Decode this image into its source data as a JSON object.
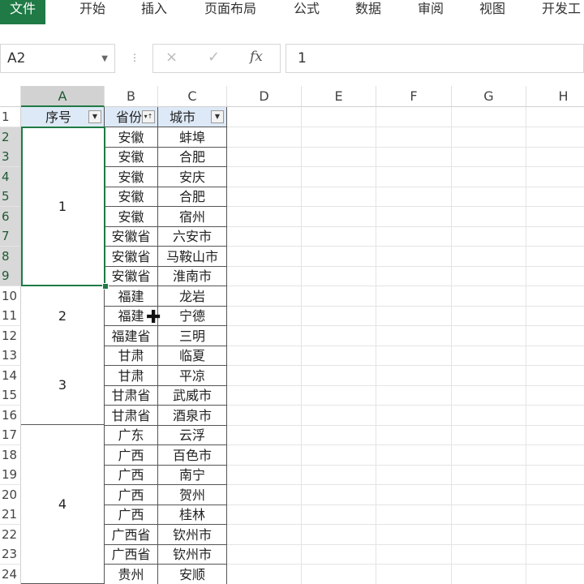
{
  "ribbon": {
    "tabs": [
      "文件",
      "开始",
      "插入",
      "页面布局",
      "公式",
      "数据",
      "审阅",
      "视图",
      "开发工"
    ]
  },
  "formula_bar": {
    "name_box": "A2",
    "cancel_glyph": "×",
    "confirm_glyph": "✓",
    "fx_label": "fx",
    "value": "1"
  },
  "columns": [
    "A",
    "B",
    "C",
    "D",
    "E",
    "F",
    "G",
    "H"
  ],
  "rows": [
    "1",
    "2",
    "3",
    "4",
    "5",
    "6",
    "7",
    "8",
    "9",
    "10",
    "11",
    "12",
    "13",
    "14",
    "15",
    "16",
    "17",
    "18",
    "19",
    "20",
    "21",
    "22",
    "23",
    "24"
  ],
  "header_row": {
    "a": "序号",
    "b": "省份",
    "c": "城市"
  },
  "merged_a": [
    {
      "rows": [
        2,
        9
      ],
      "value": "1"
    },
    {
      "rows": [
        10,
        12
      ],
      "value": "2"
    },
    {
      "rows": [
        13,
        16
      ],
      "value": "3"
    },
    {
      "rows": [
        17,
        24
      ],
      "value": "4"
    }
  ],
  "data_rows": [
    [
      "安徽",
      "蚌埠"
    ],
    [
      "安徽",
      "合肥"
    ],
    [
      "安徽",
      "安庆"
    ],
    [
      "安徽",
      "合肥"
    ],
    [
      "安徽",
      "宿州"
    ],
    [
      "安徽省",
      "六安市"
    ],
    [
      "安徽省",
      "马鞍山市"
    ],
    [
      "安徽省",
      "淮南市"
    ],
    [
      "福建",
      "龙岩"
    ],
    [
      "福建",
      "宁德"
    ],
    [
      "福建省",
      "三明"
    ],
    [
      "甘肃",
      "临夏"
    ],
    [
      "甘肃",
      "平凉"
    ],
    [
      "甘肃省",
      "武威市"
    ],
    [
      "甘肃省",
      "酒泉市"
    ],
    [
      "广东",
      "云浮"
    ],
    [
      "广西",
      "百色市"
    ],
    [
      "广西",
      "南宁"
    ],
    [
      "广西",
      "贺州"
    ],
    [
      "广西",
      "桂林"
    ],
    [
      "广西省",
      "钦州市"
    ],
    [
      "广西省",
      "钦州市"
    ],
    [
      "贵州",
      "安顺"
    ]
  ],
  "colors": {
    "accent": "#1f7a45",
    "header_fill": "#dde9f6"
  }
}
